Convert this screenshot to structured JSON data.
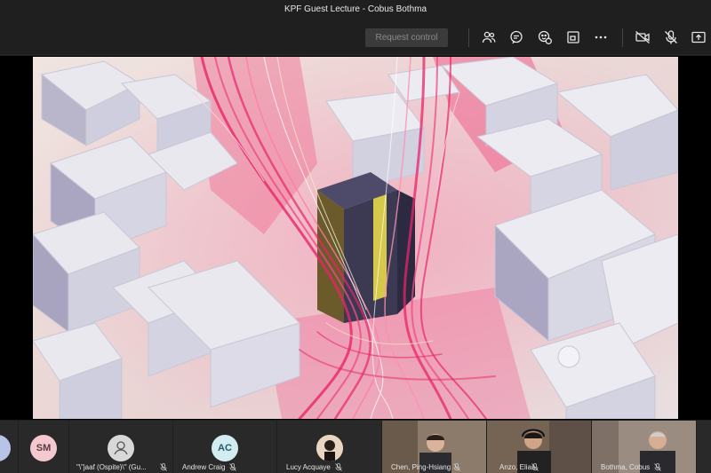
{
  "window": {
    "title": "KPF Guest Lecture - Cobus Bothma"
  },
  "toolbar": {
    "request_control_label": "Request control",
    "icons": [
      "people-icon",
      "chat-icon",
      "reactions-icon",
      "rooms-icon",
      "more-icon",
      "camera-off-icon",
      "mic-off-icon",
      "share-icon"
    ]
  },
  "shared_screen": {
    "content": "3D urban wind-flow simulation render"
  },
  "participants": [
    {
      "initials": "",
      "name": "",
      "avatar_color": "#b7c4e8"
    },
    {
      "initials": "SM",
      "name": "",
      "avatar_color": "#f3c8cf"
    },
    {
      "initials": "",
      "name": "\"\\\"jaaf (Ospite)\\\" (Gu...",
      "avatar_color": "#d8d8d8"
    },
    {
      "initials": "AC",
      "name": "Andrew Craig",
      "avatar_color": "#d3ecf2"
    },
    {
      "initials": "",
      "name": "Lucy Acquaye",
      "avatar_color": "#c9a27c"
    },
    {
      "initials": "",
      "name": "Chen, Ping-Hsiang",
      "avatar_color": "#7a6a5c"
    },
    {
      "initials": "",
      "name": "Anzo, Elias",
      "avatar_color": "#6b5a4c"
    },
    {
      "initials": "",
      "name": "Bothma, Cobus",
      "avatar_color": "#8a7d72"
    }
  ],
  "colors": {
    "background": "#1f1f1f",
    "tile": "#292929",
    "flow_accent": "#e8246a"
  }
}
